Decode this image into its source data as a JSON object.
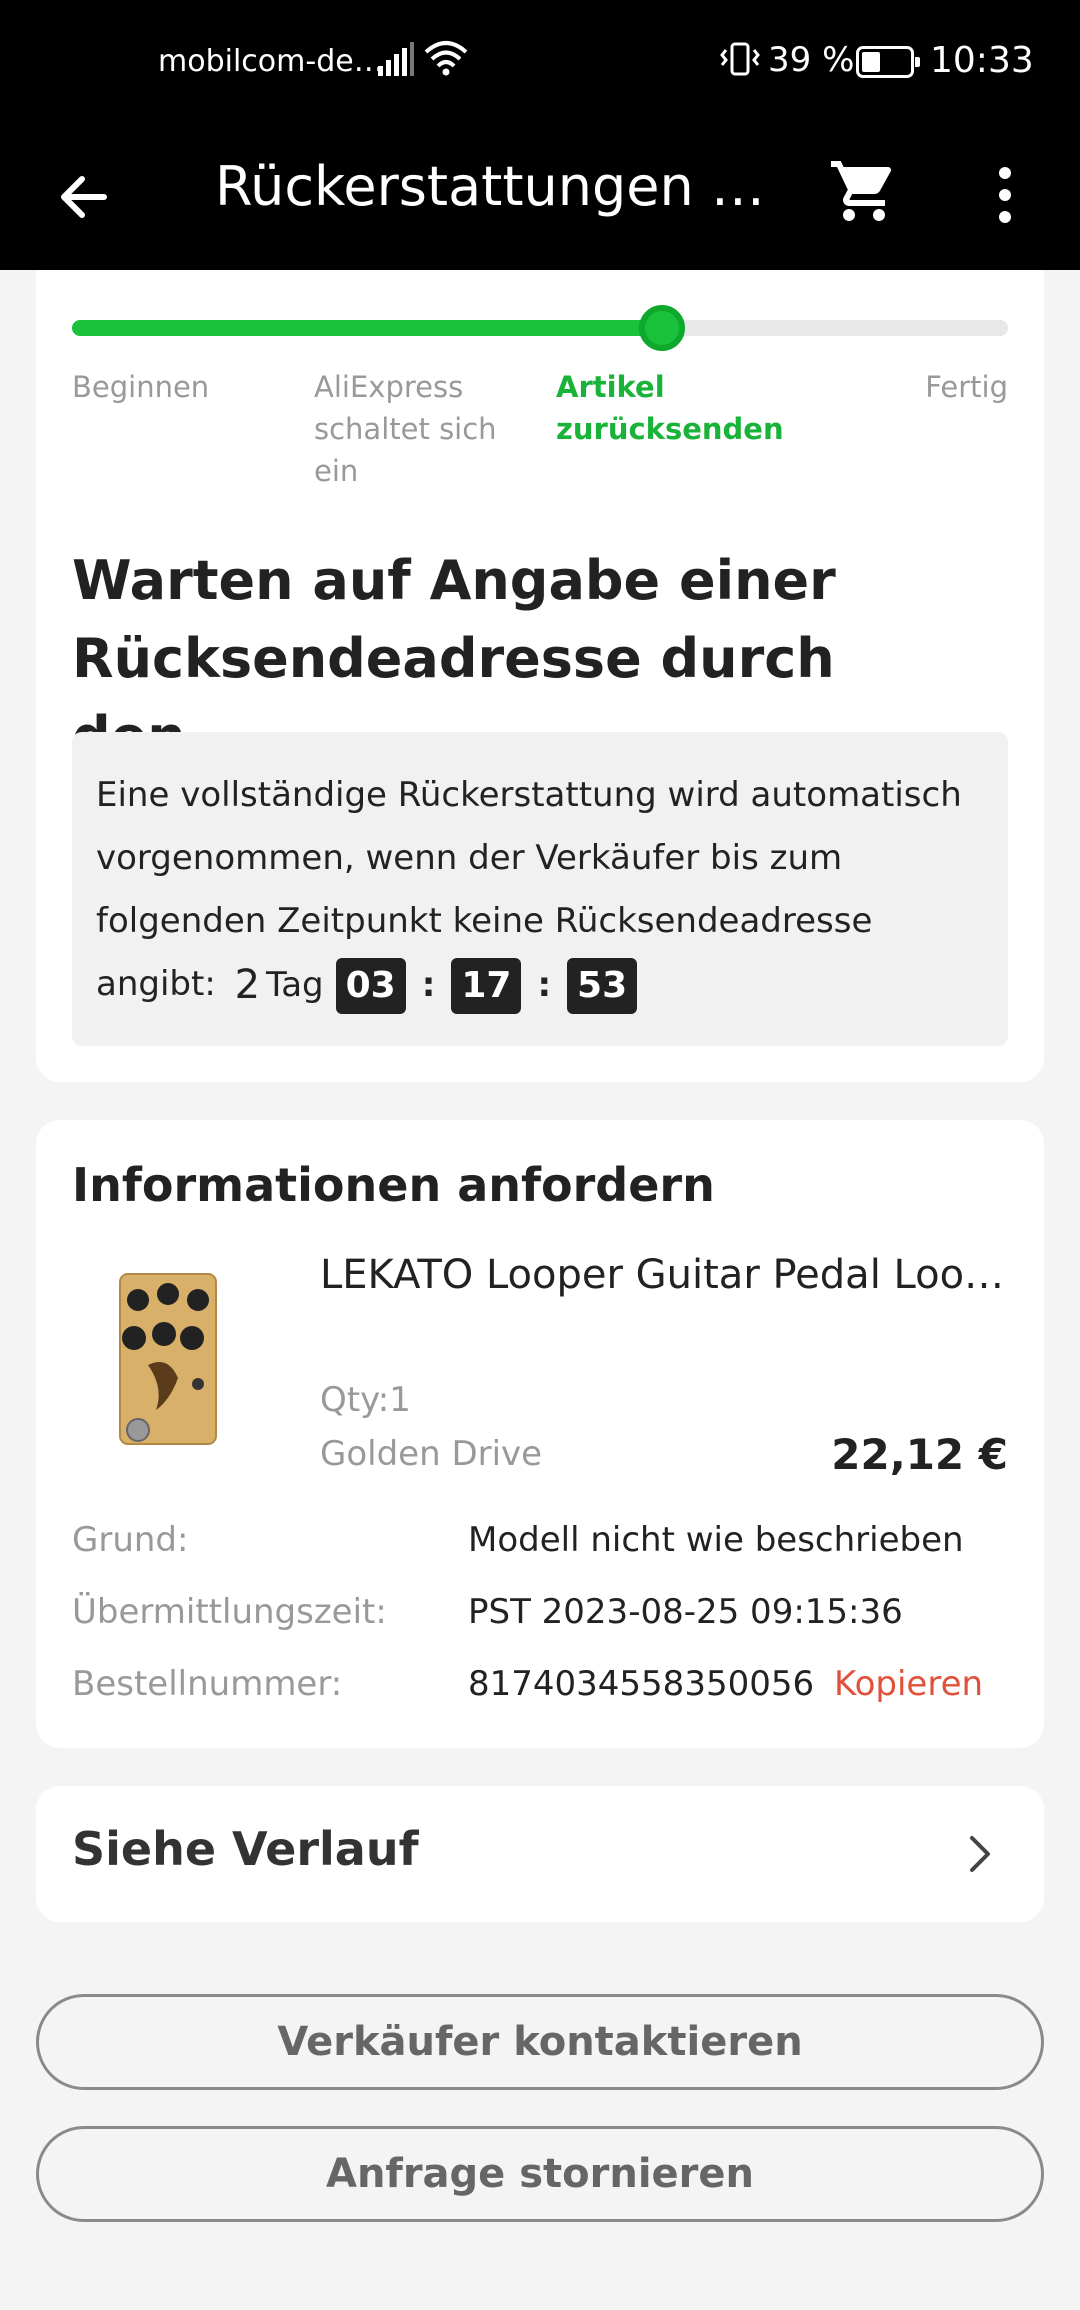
{
  "status_bar": {
    "carrier": "mobilcom-de…",
    "battery_percent": "39 %",
    "battery_level": 0.39,
    "time": "10:33",
    "icons": [
      "signal-icon",
      "wifi-icon",
      "vibrate-icon",
      "battery-icon"
    ]
  },
  "app_bar": {
    "title": "Rückerstattungen u…",
    "icons": [
      "back-arrow-icon",
      "cart-icon",
      "more-vert-icon"
    ]
  },
  "progress": {
    "fraction": 0.63,
    "steps": [
      {
        "label": "Beginnen",
        "active": false
      },
      {
        "label": "AliExpress schaltet sich ein",
        "active": false
      },
      {
        "label": "Artikel zurücksenden",
        "active": true
      },
      {
        "label": "Fertig",
        "active": false
      }
    ],
    "colors": {
      "accent": "#19c23a"
    }
  },
  "status": {
    "heading": "Warten auf Angabe einer Rücksendeadresse durch den...",
    "notice": "Eine vollständige Rückerstattung wird automatisch vorgenommen, wenn der Verkäufer bis zum folgenden Zeitpunkt keine Rücksendeadresse angibt:",
    "countdown": {
      "days": "2",
      "days_label": "Tag",
      "hours": "03",
      "minutes": "17",
      "seconds": "53",
      "separator": ":"
    }
  },
  "request_info": {
    "title": "Informationen anfordern",
    "product": {
      "name": "LEKATO Looper Guitar Pedal Loo…",
      "qty": "Qty:1",
      "variant": "Golden Drive",
      "price": "22,12 €"
    },
    "rows": [
      {
        "key": "Grund:",
        "value": "Modell nicht wie beschrieben"
      },
      {
        "key": "Übermittlungszeit:",
        "value": "PST 2023-08-25 09:15:36"
      },
      {
        "key": "Bestellnummer:",
        "value": "8174034558350056"
      }
    ],
    "copy_label": "Kopieren",
    "colors": {
      "copy": "#e0503a"
    }
  },
  "history": {
    "label": "Siehe Verlauf"
  },
  "actions": {
    "contact_seller": "Verkäufer kontaktieren",
    "cancel_request": "Anfrage stornieren"
  }
}
